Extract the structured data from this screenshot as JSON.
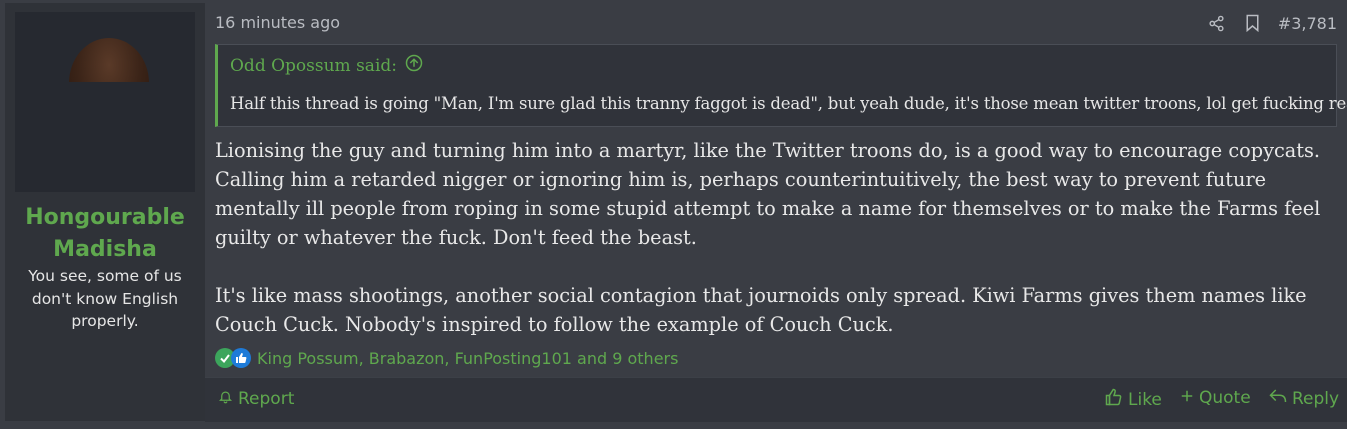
{
  "post": {
    "timestamp": "16 minutes ago",
    "number": "#3,781",
    "user": {
      "name": "Hongourable Madisha",
      "title": "You see, some of us don't know English properly."
    },
    "quote": {
      "author": "Odd Opossum said:",
      "text": "Half this thread is going \"Man, I'm sure glad this tranny faggot is dead\", but yeah dude, it's those mean twitter troons, lol get fucking real."
    },
    "body": [
      "Lionising the guy and turning him into a martyr, like the Twitter troons do, is a good way to encourage copycats. Calling him a retarded nigger or ignoring him is, perhaps counterintuitively, the best way to prevent future mentally ill people from roping in some stupid attempt to make a name for themselves or to make the Farms feel guilty or whatever the fuck. Don't feed the beast.",
      "It's like mass shootings, another social contagion that journoids only spread. Kiwi Farms gives them names like Couch Cuck. Nobody's inspired to follow the example of Couch Cuck."
    ],
    "reactions": {
      "text": "King Possum, Brabazon, FunPosting101 and 9 others",
      "icons": [
        "check-reaction-icon",
        "like-reaction-icon"
      ]
    },
    "actions": {
      "report": "Report",
      "like": "Like",
      "quote": "Quote",
      "reply": "Reply"
    }
  },
  "colors": {
    "accent": "#5fa84e",
    "background": "#3a3d44",
    "sidebar": "#2f3238",
    "text": "#e8e8e8"
  }
}
